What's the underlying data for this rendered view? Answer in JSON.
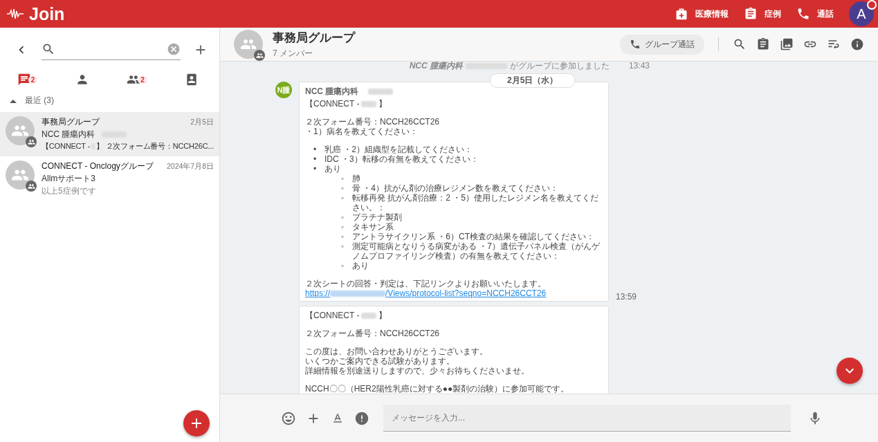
{
  "app_bar": {
    "logo": "Join",
    "nav": [
      {
        "label": "医療情報"
      },
      {
        "label": "症例"
      },
      {
        "label": "通話"
      }
    ],
    "avatar": {
      "initial": "A",
      "notification": true
    }
  },
  "sidebar": {
    "tabs": [
      {
        "selected": true,
        "badge": "2"
      },
      {
        "selected": false
      },
      {
        "selected": false,
        "badge": "2"
      },
      {
        "selected": false
      }
    ],
    "section": {
      "label": "最近 (3)",
      "expanded": true
    },
    "conversations": [
      {
        "name": "事務局グループ",
        "date": "2月5日",
        "sender": "NCC 腫瘍内科",
        "sender_redacted": true,
        "preview_prefix": "【CONNECT -",
        "preview_suffix": "】 ２次フォーム番号：NCCH26C...",
        "selected": true
      },
      {
        "name": "CONNECT - Onclogyグループ",
        "date": "2024年7月8日",
        "sender": "Allmサポート3",
        "sender_redacted": false,
        "preview_suffix": "以上5症例です",
        "selected": false
      }
    ]
  },
  "chat": {
    "title": "事務局グループ",
    "members": "7 メンバー",
    "call_button": "グループ通話",
    "system_message": {
      "sender": "NCC 腫瘍内科",
      "text": "がグループに参加しました",
      "time": "13:43"
    },
    "date_divider": "2月5日（水）",
    "messages": [
      {
        "avatar": "N腫",
        "sender": "NCC 腫瘍内科",
        "time": "13:59",
        "header_prefix": "【CONNECT -",
        "header_suffix": "】",
        "lines": [
          "２次フォーム番号：NCCH26CCT26",
          "・1）病名を教えてください："
        ],
        "bullets": [
          {
            "marker": "•",
            "text": "乳癌 ・2）組織型を記載してください："
          },
          {
            "marker": "•",
            "text": "IDC ・3）転移の有無を教えてください："
          },
          {
            "marker": "•",
            "text": "あり",
            "children": [
              {
                "marker": "◦",
                "text": "肺"
              },
              {
                "marker": "◦",
                "text": "骨 ・4）抗がん剤の治療レジメン数を教えてください："
              },
              {
                "marker": "◦",
                "text": "転移再発 抗がん剤治療：2 ・5）使用したレジメン名を教えてください。："
              },
              {
                "marker": "◦",
                "text": "プラチナ製剤"
              },
              {
                "marker": "◦",
                "text": "タキサン系"
              },
              {
                "marker": "◦",
                "text": "アントラサイクリン系 ・6）CT検査の結果を確認してください："
              },
              {
                "marker": "◦",
                "text": "測定可能病となりうる病変がある ・7）遺伝子パネル検査（がんゲノムプロファイリング検査）の有無を教えてください："
              },
              {
                "marker": "◦",
                "text": "あり"
              }
            ]
          }
        ],
        "footer": "２次シートの回答・判定は、下記リンクよりお願いいたします。",
        "link_prefix": "https://",
        "link_suffix": "/Views/protocol-list?seqno=NCCH26CCT26"
      },
      {
        "header_prefix": "【CONNECT -",
        "header_suffix": "】",
        "lines": [
          "２次フォーム番号：NCCH26CCT26"
        ],
        "paragraphs": [
          [
            "この度は、お問い合わせありがとうございます。",
            "いくつかご案内できる試験があります。",
            "詳細情報を別途送りしますので、少々お待ちくださいませ。"
          ],
          [
            "NCCH〇〇（HER2陽性乳癌に対する●●製剤の治験）に参加可能です。"
          ]
        ]
      }
    ]
  },
  "composer": {
    "placeholder": "メッセージを入力..."
  }
}
